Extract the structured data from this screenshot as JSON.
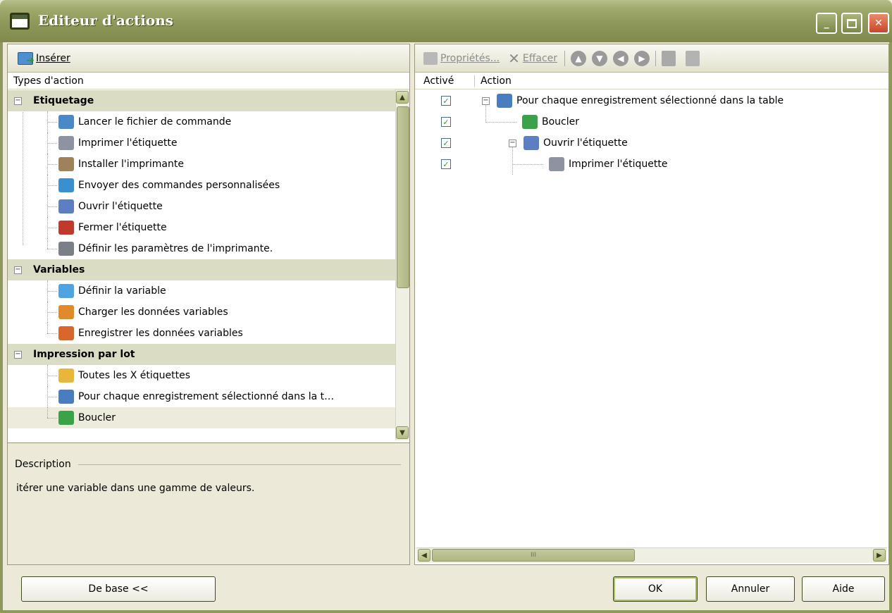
{
  "window": {
    "title": "Editeur d'actions"
  },
  "left": {
    "insert_label": "Insérer",
    "column_header": "Types d'action",
    "groups": [
      {
        "label": "Etiquetage",
        "items": [
          "Lancer le fichier de commande",
          "Imprimer l'étiquette",
          "Installer l'imprimante",
          "Envoyer des commandes personnalisées",
          "Ouvrir l'étiquette",
          "Fermer l'étiquette",
          "Définir les paramètres de l'imprimante."
        ]
      },
      {
        "label": "Variables",
        "items": [
          "Définir la variable",
          "Charger les données variables",
          "Enregistrer les données variables"
        ]
      },
      {
        "label": "Impression par lot",
        "items": [
          "Toutes les  X  étiquettes",
          "Pour chaque enregistrement sélectionné dans la t…",
          "Boucler"
        ]
      }
    ],
    "description": {
      "label": "Description",
      "text": "itérer une variable dans une gamme de valeurs."
    }
  },
  "right": {
    "toolbar": {
      "properties": "Propriétés...",
      "delete": "Effacer"
    },
    "columns": {
      "enabled": "Activé",
      "action": "Action"
    },
    "actions": [
      {
        "label": "Pour chaque enregistrement sélectionné dans la table",
        "enabled": true
      },
      {
        "label": "Boucler",
        "enabled": true
      },
      {
        "label": "Ouvrir l'étiquette",
        "enabled": true
      },
      {
        "label": "Imprimer l'étiquette",
        "enabled": true
      }
    ],
    "scroll_glyph": "III"
  },
  "buttons": {
    "basic": "De base <<",
    "ok": "OK",
    "cancel": "Annuler",
    "help": "Aide"
  },
  "colors": {
    "title": "#8e985a",
    "group": "#dbdcc4",
    "check": "#2aa02a"
  }
}
